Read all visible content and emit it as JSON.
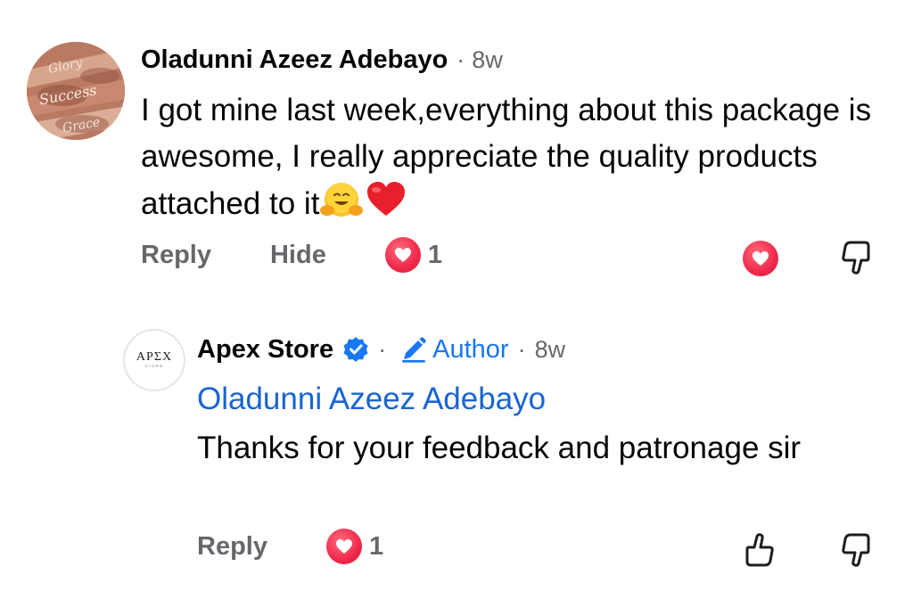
{
  "comments": [
    {
      "author": "Oladunni Azeez Adebayo",
      "separator": "·",
      "time": "8w",
      "text": "I got mine last week,everything about this package is awesome, I really appreciate the quality products attached to it",
      "emojis": [
        "hugging-face",
        "red-heart"
      ],
      "actions": {
        "reply": "Reply",
        "hide": "Hide"
      },
      "reaction_count": "1",
      "avatar_text": [
        "Glory",
        "Success",
        "Grace"
      ]
    },
    {
      "author": "Apex Store",
      "separator": "·",
      "author_badge": "Author",
      "separator2": "·",
      "time": "8w",
      "mention": "Oladunni Azeez Adebayo",
      "text": "Thanks for your feedback and patronage sir",
      "actions": {
        "reply": "Reply"
      },
      "reaction_count": "1",
      "avatar_logo": "APƩX",
      "avatar_subtext": "STORE"
    }
  ],
  "colors": {
    "text_primary": "#050505",
    "text_secondary": "#65676b",
    "link_blue": "#1a64d2",
    "verified_blue": "#1877f2",
    "reaction_red": "#f0284a"
  }
}
